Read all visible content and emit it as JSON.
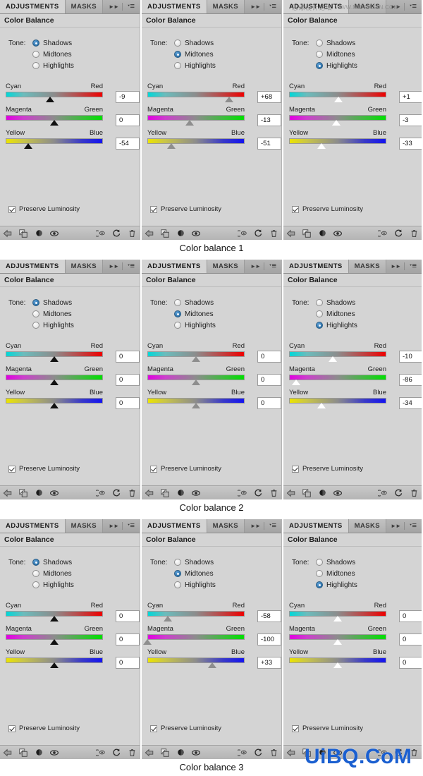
{
  "window": {
    "tabs": {
      "adjustments": "ADJUSTMENTS",
      "masks": "MASKS"
    },
    "icons": {
      "collapse": "double-chevron-right-icon",
      "menu": "panel-menu-icon"
    },
    "panel_title": "Color Balance"
  },
  "labels": {
    "tone": "Tone:",
    "shadows": "Shadows",
    "midtones": "Midtones",
    "highlights": "Highlights",
    "cyan": "Cyan",
    "red": "Red",
    "magenta": "Magenta",
    "green": "Green",
    "yellow": "Yellow",
    "blue": "Blue",
    "preserve_luminosity": "Preserve Luminosity"
  },
  "footer_icons": [
    "back-arrow-icon",
    "clip-to-layer-icon",
    "toggle-layer-visibility-icon",
    "preview-eye-icon",
    "mask-preview-icon",
    "reset-icon",
    "delete-trash-icon"
  ],
  "colors": {
    "panel_bg": "#d4d4d4",
    "tab_active_bg": "#d4d4d4",
    "radio_on": "#1a5f97",
    "watermark_blue": "#1a5fd0",
    "cyan": "#00d8d8",
    "red": "#ee0000",
    "magenta": "#e000e0",
    "green": "#00e000",
    "yellow": "#ece400",
    "blue": "#1414f0"
  },
  "captions": [
    "Color balance 1",
    "Color balance 2",
    "Color balance 3"
  ],
  "watermarks": {
    "chinese": "思缘设计论坛",
    "chinese_url": "WWW.MISSYUAN.COM",
    "bottom": "UiBQ.CoM"
  },
  "rows": [
    {
      "caption": "Color balance 1",
      "panels": [
        {
          "tone": "shadows",
          "cyan_red": "-9",
          "magenta_green": "0",
          "yellow_blue": "-54",
          "preserve": true
        },
        {
          "tone": "midtones",
          "cyan_red": "+68",
          "magenta_green": "-13",
          "yellow_blue": "-51",
          "preserve": true
        },
        {
          "tone": "highlights",
          "cyan_red": "+1",
          "magenta_green": "-3",
          "yellow_blue": "-33",
          "preserve": true
        }
      ]
    },
    {
      "caption": "Color balance 2",
      "panels": [
        {
          "tone": "shadows",
          "cyan_red": "0",
          "magenta_green": "0",
          "yellow_blue": "0",
          "preserve": true
        },
        {
          "tone": "midtones",
          "cyan_red": "0",
          "magenta_green": "0",
          "yellow_blue": "0",
          "preserve": true
        },
        {
          "tone": "highlights",
          "cyan_red": "-10",
          "magenta_green": "-86",
          "yellow_blue": "-34",
          "preserve": true
        }
      ]
    },
    {
      "caption": "Color balance 3",
      "panels": [
        {
          "tone": "shadows",
          "cyan_red": "0",
          "magenta_green": "0",
          "yellow_blue": "0",
          "preserve": true
        },
        {
          "tone": "midtones",
          "cyan_red": "-58",
          "magenta_green": "-100",
          "yellow_blue": "+33",
          "preserve": true
        },
        {
          "tone": "highlights",
          "cyan_red": "0",
          "magenta_green": "0",
          "yellow_blue": "0",
          "preserve": true
        }
      ]
    }
  ]
}
